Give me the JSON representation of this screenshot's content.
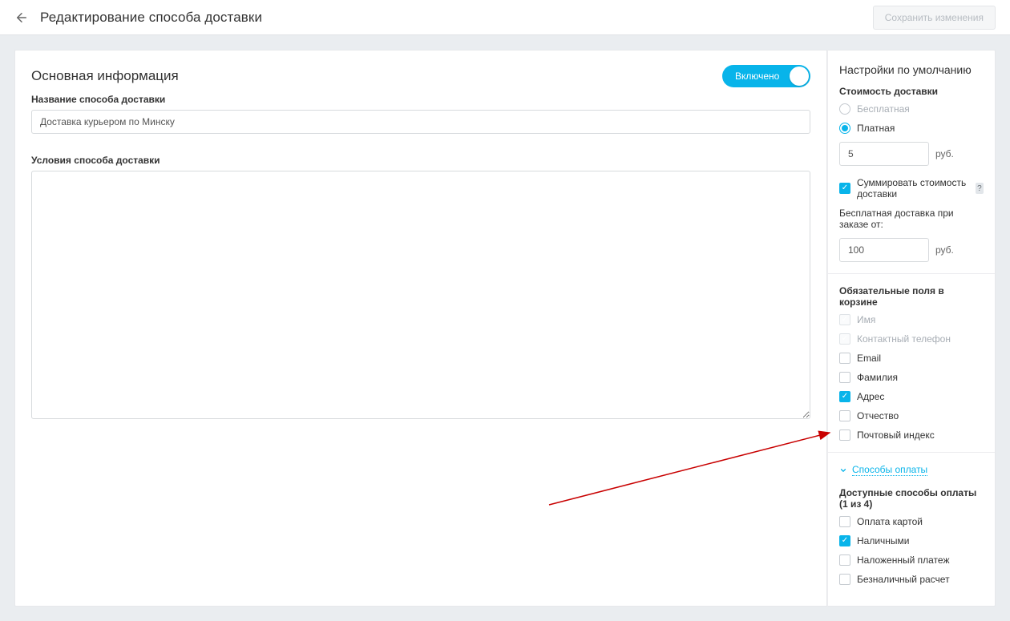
{
  "topbar": {
    "title": "Редактирование способа доставки",
    "save_label": "Сохранить изменения"
  },
  "main": {
    "section_title": "Основная информация",
    "toggle_label": "Включено",
    "name_label": "Название способа доставки",
    "name_value": "Доставка курьером по Минску",
    "conditions_label": "Условия способа доставки",
    "conditions_value": ""
  },
  "sidebar": {
    "title": "Настройки по умолчанию",
    "cost_section_label": "Стоимость доставки",
    "radio_free": "Бесплатная",
    "radio_paid": "Платная",
    "price_value": "5",
    "currency_unit": "руб.",
    "sum_label": "Суммировать стоимость доставки",
    "help_symbol": "?",
    "free_from_label": "Бесплатная доставка при заказе от:",
    "free_from_value": "100",
    "required_fields_label": "Обязательные поля в корзине",
    "required_fields": [
      {
        "label": "Имя",
        "checked": true,
        "disabled": true
      },
      {
        "label": "Контактный телефон",
        "checked": true,
        "disabled": true
      },
      {
        "label": "Email",
        "checked": false,
        "disabled": false
      },
      {
        "label": "Фамилия",
        "checked": false,
        "disabled": false
      },
      {
        "label": "Адрес",
        "checked": true,
        "disabled": false
      },
      {
        "label": "Отчество",
        "checked": false,
        "disabled": false
      },
      {
        "label": "Почтовый индекс",
        "checked": false,
        "disabled": false
      }
    ],
    "payment_link": "Способы оплаты",
    "available_payment_label": "Доступные способы оплаты (1 из 4)",
    "payment_methods": [
      {
        "label": "Оплата картой",
        "checked": false
      },
      {
        "label": "Наличными",
        "checked": true
      },
      {
        "label": "Наложенный платеж",
        "checked": false
      },
      {
        "label": "Безналичный расчет",
        "checked": false
      }
    ]
  }
}
